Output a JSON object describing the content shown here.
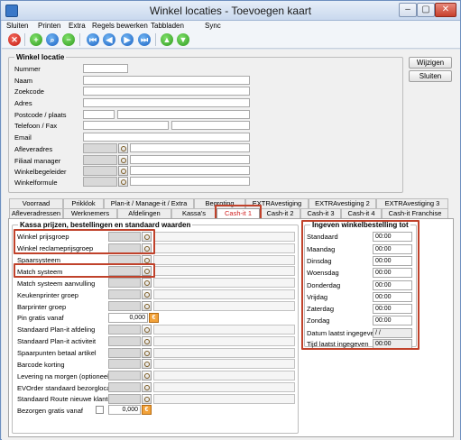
{
  "window": {
    "title": "Winkel locaties - Toevoegen kaart"
  },
  "menu": [
    "Sluiten",
    "Printen",
    "Extra",
    "Regels bewerken",
    "Tabbladen",
    "Sync"
  ],
  "toolbar_icons": [
    "close-icon",
    "add-icon",
    "search-icon",
    "remove-icon",
    "first-icon",
    "previous-icon",
    "next-icon",
    "last-icon",
    "up-icon",
    "down-icon"
  ],
  "buttons": {
    "wijzigen": "Wijzigen",
    "sluiten": "Sluiten"
  },
  "location": {
    "legend": "Winkel locatie",
    "fields": [
      "Nummer",
      "Naam",
      "Zoekcode",
      "Adres",
      "Postcode / plaats",
      "Telefoon / Fax",
      "Email",
      "Afleveradres",
      "Filiaal manager",
      "Winkelbegeleider",
      "Winkelformule"
    ]
  },
  "tabs_row1": [
    "Voorraad",
    "Prikklok",
    "Plan-it / Manage-it / Extra",
    "Begroting",
    "EXTRAvestiging",
    "EXTRAvestiging 2",
    "EXTRAvestiging 3"
  ],
  "tabs_row2": [
    "Afleveradressen",
    "Werknemers",
    "Afdelingen",
    "Kassa's",
    "Cash-it 1",
    "Cash-it 2",
    "Cash-it 3",
    "Cash-it 4",
    "Cash-it Franchise"
  ],
  "kassa": {
    "legend": "Kassa prijzen, bestellingen en standaard waarden",
    "rows": [
      "Winkel prijsgroep",
      "Winkel reclameprijsgroep",
      "Spaarsysteem",
      "Match systeem",
      "Match systeem aanvulling",
      "Keukenprinter groep",
      "Barprinter groep",
      "Pin gratis vanaf",
      "Standaard Plan-it afdeling",
      "Standaard Plan-it activiteit",
      "Spaarpunten betaal artikel",
      "Barcode korting",
      "Levering na morgen (optioneel)",
      "EVOrder standaard bezorglocatie",
      "Standaard Route nieuwe klanten",
      "Bezorgen gratis vanaf"
    ],
    "pin_value": "0,000",
    "bezorgen_value": "0,000"
  },
  "bestelling": {
    "legend": "Ingeven winkelbestelling tot",
    "rows": [
      {
        "label": "Standaard",
        "value": "00:00"
      },
      {
        "label": "Maandag",
        "value": "00:00"
      },
      {
        "label": "Dinsdag",
        "value": "00:00"
      },
      {
        "label": "Woensdag",
        "value": "00:00"
      },
      {
        "label": "Donderdag",
        "value": "00:00"
      },
      {
        "label": "Vrijdag",
        "value": "00:00"
      },
      {
        "label": "Zaterdag",
        "value": "00:00"
      },
      {
        "label": "Zondag",
        "value": "00:00"
      }
    ],
    "datum_label": "Datum laatst ingegeven",
    "datum_value": "/ /",
    "tijd_label": "Tijd laatst ingegeven",
    "tijd_value": "00:00"
  },
  "colors": {
    "highlight": "#c0422b",
    "active_tab_text": "#d02020"
  }
}
